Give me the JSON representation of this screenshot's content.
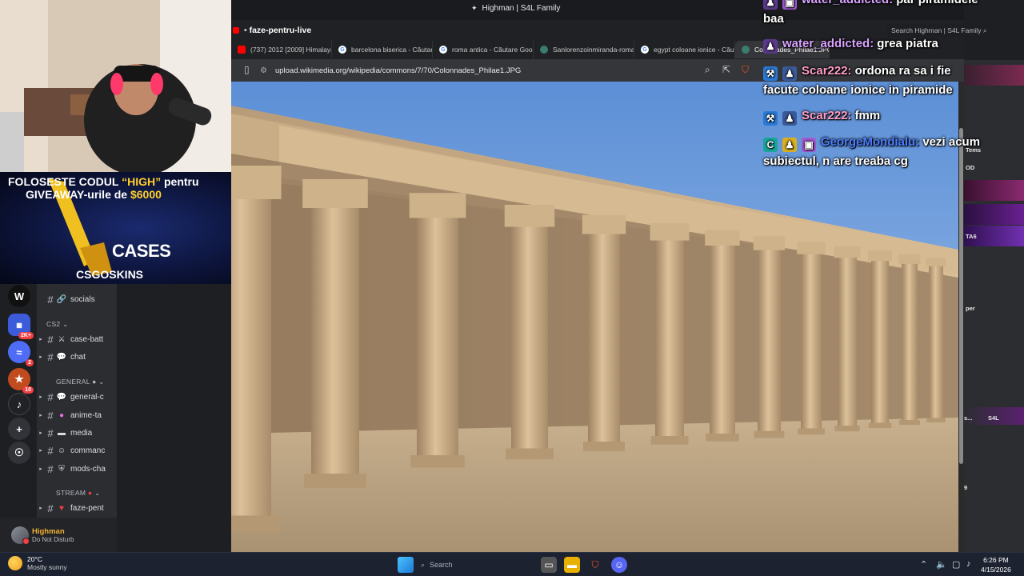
{
  "window": {
    "title": "Highman | S4L Family"
  },
  "stream": {
    "title": "faze-pentru-live"
  },
  "tabs": [
    {
      "label": "(737) 2012 [2009] Himalaya",
      "favicon": "youtube-icon",
      "color": "#ff0000"
    },
    {
      "label": "barcelona biserica - Căutare",
      "favicon": "google-icon",
      "color": "#4285f4"
    },
    {
      "label": "roma antica - Căutare Google",
      "favicon": "google-icon",
      "color": "#4285f4"
    },
    {
      "label": "Sanlorenzoinmiranda-roma",
      "favicon": "wikimedia-icon",
      "color": "#3a7d6f"
    },
    {
      "label": "egypt coloane ionice - Căutare",
      "favicon": "google-icon",
      "color": "#4285f4"
    },
    {
      "label": "Colonnades_Philae1.JPG",
      "favicon": "wikimedia-icon",
      "color": "#3a7d6f",
      "active": true
    }
  ],
  "browser": {
    "url": "upload.wikimedia.org/wikipedia/commons/7/70/Colonnades_Philae1.JPG",
    "discord_search_placeholder": "Search Highman | S4L Family"
  },
  "promo": {
    "line1_prefix": "FOLOSESTE CODUL ",
    "line1_code": "“HIGH”",
    "line1_suffix": " pentru",
    "line2_prefix": "GIVEAWAY-urile de ",
    "line2_amount": "$6000",
    "cases": "CASES",
    "skins": "CSGOSKINS"
  },
  "chat": [
    {
      "user": "water_addicted:",
      "user_color": "#d9a3ff",
      "text": "par piramidele",
      "text2": "baa"
    },
    {
      "user": "water_addicted:",
      "user_color": "#d9a3ff",
      "text": "grea piatra"
    },
    {
      "user": "Scar222:",
      "user_color": "#ff9ec7",
      "text": "ordona ra sa i fie",
      "text2": "facute coloane ionice in piramide"
    },
    {
      "user": "Scar222:",
      "user_color": "#ff9ec7",
      "text": "fmm"
    },
    {
      "user": "GeorgeMondialu:",
      "user_color": "#4a7dff",
      "text": "vezi acum",
      "text2": "subiectul, n are treaba cg"
    }
  ],
  "discord": {
    "channels": [
      {
        "name": "socials",
        "icon": "link-icon"
      },
      {
        "name": "case-batt",
        "icon": "swords-icon"
      },
      {
        "name": "chat",
        "icon": "speech-icon"
      },
      {
        "name": "general-c",
        "icon": "speech-icon"
      },
      {
        "name": "anime-ta",
        "icon": "circle-icon"
      },
      {
        "name": "media",
        "icon": "film-icon"
      },
      {
        "name": "commanc",
        "icon": "robot-icon"
      },
      {
        "name": "mods-cha",
        "icon": "shield-icon"
      },
      {
        "name": "faze-pent",
        "icon": "heart-icon"
      }
    ],
    "categories": {
      "cs2": "CS2",
      "general": "GENERAL",
      "stream": "STREAM"
    },
    "servers": [
      {
        "label": "W",
        "color": "#222",
        "badge": ""
      },
      {
        "label": "2K+",
        "color": "#3b5bdb",
        "badge": "2K+"
      },
      {
        "label": "≈",
        "color": "#4f6cf7",
        "badge": "2"
      },
      {
        "label": "★",
        "color": "#c14a1e",
        "badge": "10"
      },
      {
        "label": "♪",
        "color": "#202225",
        "badge": ""
      },
      {
        "label": "+",
        "color": "#313338",
        "badge": ""
      },
      {
        "label": "☉",
        "color": "#313338",
        "badge": ""
      }
    ],
    "user": {
      "name": "Highman",
      "status": "Do Not Disturb"
    },
    "member_bits": [
      "Tems",
      "OD",
      "TA6",
      "per",
      "s...",
      "S4L",
      "9"
    ]
  },
  "taskbar": {
    "weather_temp": "20°C",
    "weather_desc": "Mostly sunny",
    "search": "Search",
    "time": "6:26 PM",
    "date": "4/15/2026"
  }
}
